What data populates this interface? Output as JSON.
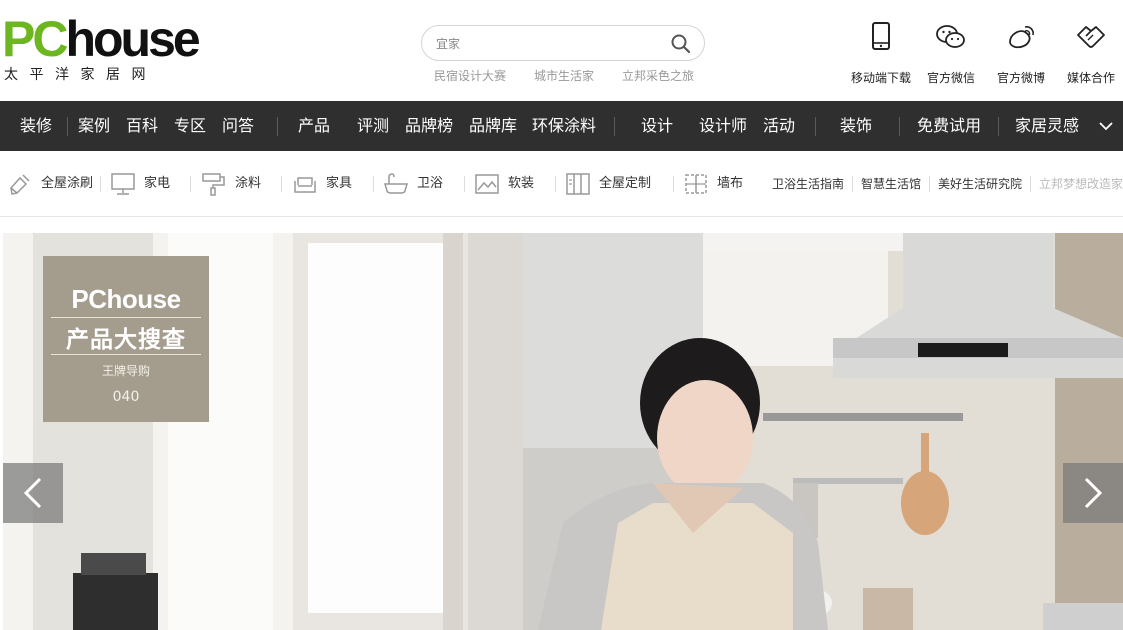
{
  "header": {
    "logo": {
      "letter_p": "P",
      "letter_c": "C",
      "rest": "house",
      "subtitle": "太平洋家居网"
    },
    "search": {
      "placeholder": "宜家",
      "icon": "search-icon"
    },
    "hot_links": [
      "民宿设计大赛",
      "城市生活家",
      "立邦采色之旅"
    ],
    "tools": [
      {
        "label": "移动端下载",
        "icon": "mobile-icon"
      },
      {
        "label": "官方微信",
        "icon": "wechat-icon"
      },
      {
        "label": "官方微博",
        "icon": "weibo-icon"
      },
      {
        "label": "媒体合作",
        "icon": "handshake-icon"
      }
    ]
  },
  "nav": {
    "items": [
      "装修",
      "案例",
      "百科",
      "专区",
      "问答",
      "产品",
      "评测",
      "品牌榜",
      "品牌库",
      "环保涂料",
      "设计",
      "设计师",
      "活动",
      "装饰",
      "免费试用",
      "家居灵感"
    ],
    "more_icon": "chevron-down-icon"
  },
  "categories": {
    "items": [
      {
        "label": "全屋涂刷",
        "icon": "brush-icon"
      },
      {
        "label": "家电",
        "icon": "monitor-icon"
      },
      {
        "label": "涂料",
        "icon": "paint-roller-icon"
      },
      {
        "label": "家具",
        "icon": "sofa-icon"
      },
      {
        "label": "卫浴",
        "icon": "bathtub-icon"
      },
      {
        "label": "软装",
        "icon": "picture-icon"
      },
      {
        "label": "全屋定制",
        "icon": "wardrobe-icon"
      },
      {
        "label": "墙布",
        "icon": "wallcloth-icon"
      }
    ],
    "links": [
      "卫浴生活指南",
      "智慧生活馆",
      "美好生活研究院"
    ],
    "muted_link": "立邦梦想改造家"
  },
  "hero": {
    "promo": {
      "brand": "PChouse",
      "title": "产品大搜查",
      "subtitle": "王牌导购",
      "number": "040"
    },
    "prev_icon": "chevron-left-icon",
    "next_icon": "chevron-right-icon"
  },
  "colors": {
    "brand_green": "#6cb61f",
    "nav_bg": "#2f2f2f",
    "promo_bg": "#a49c8d"
  }
}
